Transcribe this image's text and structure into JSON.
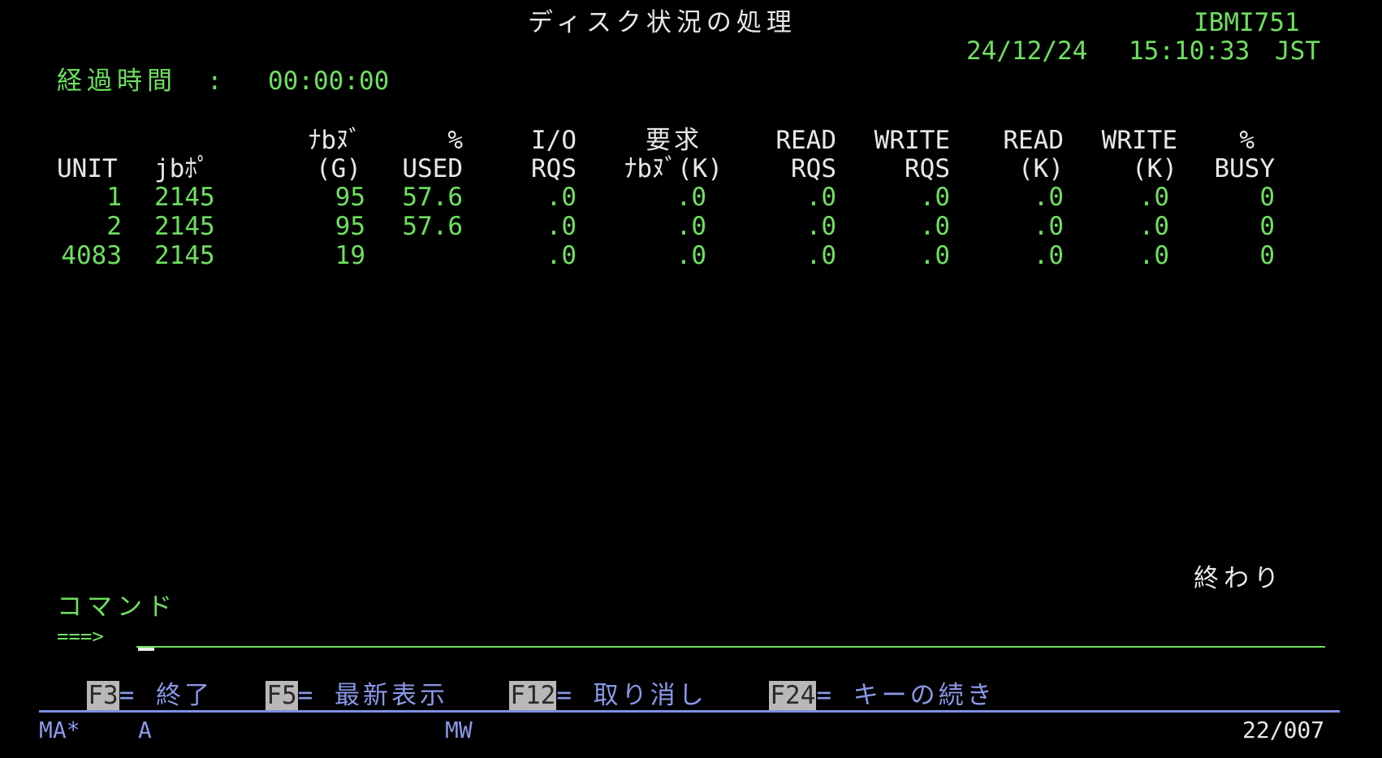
{
  "header": {
    "title": "ディスク状況の処理",
    "system": "IBMI751",
    "date": "24/12/24",
    "time": "15:10:33",
    "timezone": "JST",
    "elapsed_label": "経過時間　:",
    "elapsed_value": "00:00:00"
  },
  "table": {
    "header_top": [
      "",
      "",
      "ﾅbﾇﾞ",
      "%",
      "I/O",
      "要求",
      "READ",
      "WRITE",
      "READ",
      "WRITE",
      "%"
    ],
    "header_bottom": [
      "UNIT",
      "jbﾎﾟ",
      "(G)",
      "USED",
      "RQS",
      "ﾅbﾇﾞ(K)",
      "RQS",
      "RQS",
      "(K)",
      "(K)",
      "BUSY"
    ],
    "rows": [
      [
        "1",
        "2145",
        "95",
        "57.6",
        ".0",
        ".0",
        ".0",
        ".0",
        ".0",
        ".0",
        "0"
      ],
      [
        "2",
        "2145",
        "95",
        "57.6",
        ".0",
        ".0",
        ".0",
        ".0",
        ".0",
        ".0",
        "0"
      ],
      [
        "4083",
        "2145",
        "19",
        "",
        ".0",
        ".0",
        ".0",
        ".0",
        ".0",
        ".0",
        "0"
      ]
    ]
  },
  "more_indicator": "終わり",
  "command": {
    "label": "コマンド",
    "prompt": "===>",
    "value": ""
  },
  "function_keys": [
    {
      "key": "F3",
      "label": "= 終了"
    },
    {
      "key": "F5",
      "label": "= 最新表示"
    },
    {
      "key": "F12",
      "label": "= 取り消し"
    },
    {
      "key": "F24",
      "label": "= キーの続き"
    }
  ],
  "status_bar": {
    "left": "MA*",
    "mode": "A",
    "center": "MW",
    "position": "22/007"
  },
  "colors": {
    "background": "#000000",
    "field_green": "#6ee05f",
    "title_white": "#e8e8e8",
    "fkey_blue": "#8a98e8"
  }
}
